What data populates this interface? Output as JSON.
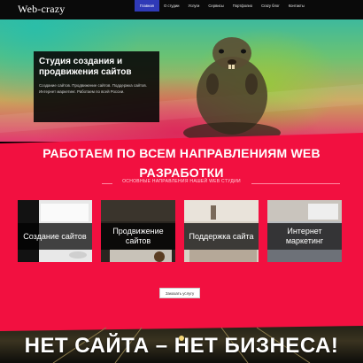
{
  "header": {
    "logo": "Web-crazy",
    "nav": [
      {
        "label": "Главная",
        "active": true
      },
      {
        "label": "О студии",
        "active": false
      },
      {
        "label": "Услуги",
        "active": false
      },
      {
        "label": "Сервисы",
        "active": false
      },
      {
        "label": "Портфолио",
        "active": false
      },
      {
        "label": "Crazy блог",
        "active": false
      },
      {
        "label": "Контакты",
        "active": false
      }
    ]
  },
  "hero": {
    "title": "Студия создания и продвижения сайтов",
    "text": "Создание сайтов. Продвижение сайтов. Поддержка сайтов. Интернет маркетинг. Работаем по всей России."
  },
  "services": {
    "title": "РАБОТАЕМ ПО ВСЕМ НАПРАВЛЕНИЯМ WEB РАЗРАБОТКИ",
    "subtitle": "ОСНОВНЫЕ НАПРАВЛЕНИЯ НАШЕЙ WEB СТУДИИ",
    "cards": [
      {
        "label": "Создание сайтов"
      },
      {
        "label": "Продвижение сайтов"
      },
      {
        "label": "Поддержка сайта"
      },
      {
        "label": "Интернет маркетинг"
      }
    ],
    "cta": "Заказать услугу"
  },
  "banner": {
    "title": "НЕТ САЙТА – НЕТ БИЗНЕСА!"
  },
  "colors": {
    "nav_active": "#2f3ab7",
    "services_bg": "#f21040"
  }
}
